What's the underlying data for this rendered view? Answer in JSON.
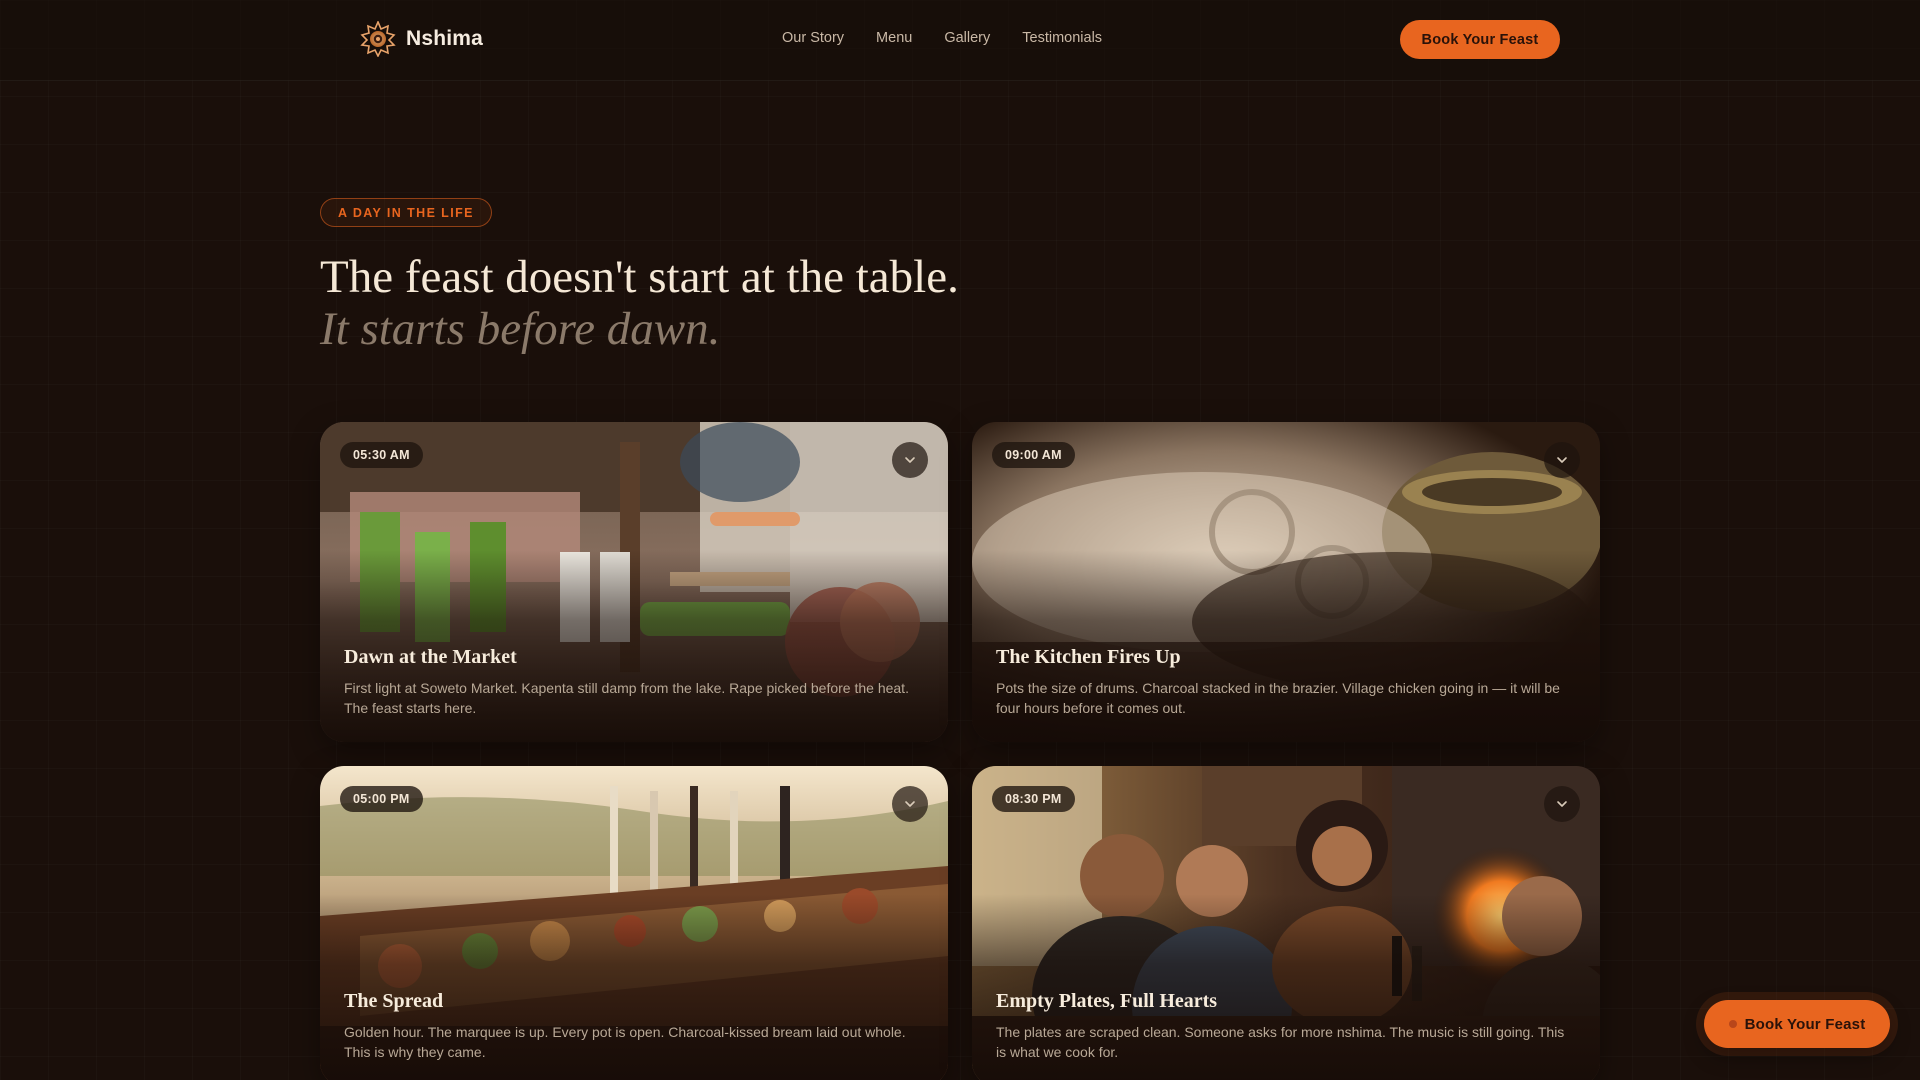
{
  "brand": {
    "name": "Nshima"
  },
  "nav": {
    "items": [
      "Our Story",
      "Menu",
      "Gallery",
      "Testimonials"
    ]
  },
  "header": {
    "cta_label": "Book Your Feast"
  },
  "hero": {
    "eyebrow": "A DAY IN THE LIFE",
    "headline": "The feast doesn't start at the table.",
    "subheadline": "It starts before dawn."
  },
  "cards": [
    {
      "time": "05:30 AM",
      "title": "Dawn at the Market",
      "description": "First light at Soweto Market. Kapenta still damp from the lake. Rape picked before the heat. The feast starts here.",
      "image": "market-stall-photo"
    },
    {
      "time": "09:00 AM",
      "title": "The Kitchen Fires Up",
      "description": "Pots the size of drums. Charcoal stacked in the brazier. Village chicken going in — it will be four hours before it comes out.",
      "image": "steaming-pots-photo"
    },
    {
      "time": "05:00 PM",
      "title": "The Spread",
      "description": "Golden hour. The marquee is up. Every pot is open. Charcoal-kissed bream laid out whole. This is why they came.",
      "image": "banquet-table-photo"
    },
    {
      "time": "08:30 PM",
      "title": "Empty Plates, Full Hearts",
      "description": "The plates are scraped clean. Someone asks for more nshima. The music is still going. This is what we cook for.",
      "image": "dinner-guests-photo"
    }
  ],
  "floating_cta": {
    "label": "Book Your Feast"
  },
  "colors": {
    "background": "#1a0f0a",
    "accent": "#e8651f",
    "heading": "#f5e8d6",
    "muted": "#8b7a6a"
  }
}
